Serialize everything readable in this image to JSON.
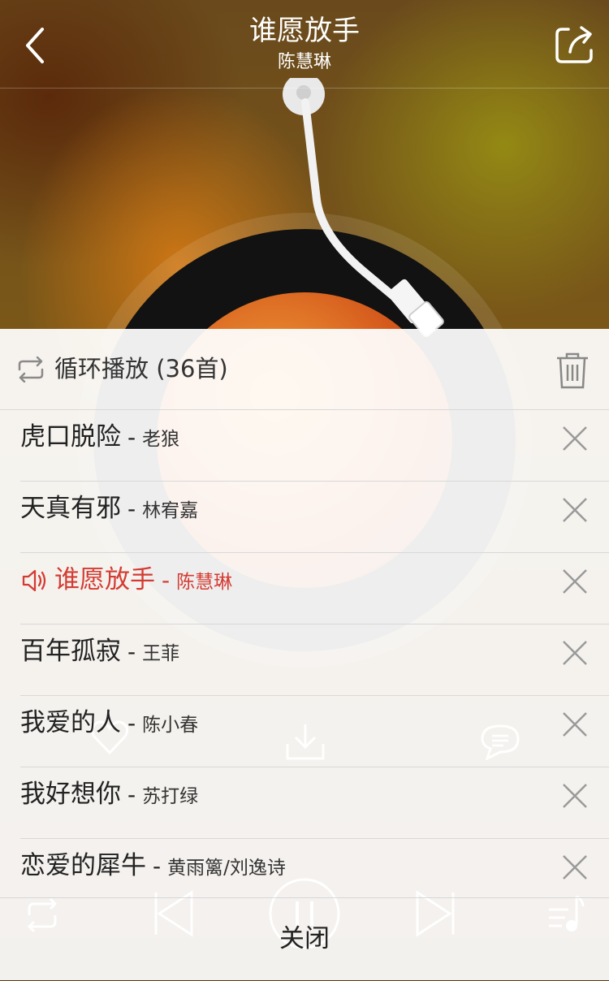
{
  "player": {
    "song_title": "谁愿放手",
    "artist": "陈慧琳",
    "icons": [
      "back-icon",
      "share-icon",
      "heart-icon",
      "download-icon",
      "comment-icon",
      "loop-icon",
      "prev-icon",
      "pause-icon",
      "next-icon",
      "playlist-icon"
    ]
  },
  "playlist": {
    "mode_label": "循环播放 (36首)",
    "separator": "-",
    "close_label": "关闭",
    "accent_color": "#d43c33",
    "items": [
      {
        "name": "虎口脱险",
        "artist": "老狼",
        "playing": false
      },
      {
        "name": "天真有邪",
        "artist": "林宥嘉",
        "playing": false
      },
      {
        "name": "谁愿放手",
        "artist": "陈慧琳",
        "playing": true
      },
      {
        "name": "百年孤寂",
        "artist": "王菲",
        "playing": false
      },
      {
        "name": "我爱的人",
        "artist": "陈小春",
        "playing": false
      },
      {
        "name": "我好想你",
        "artist": "苏打绿",
        "playing": false
      },
      {
        "name": "恋爱的犀牛",
        "artist": "黄雨篱/刘逸诗",
        "playing": false
      }
    ]
  }
}
